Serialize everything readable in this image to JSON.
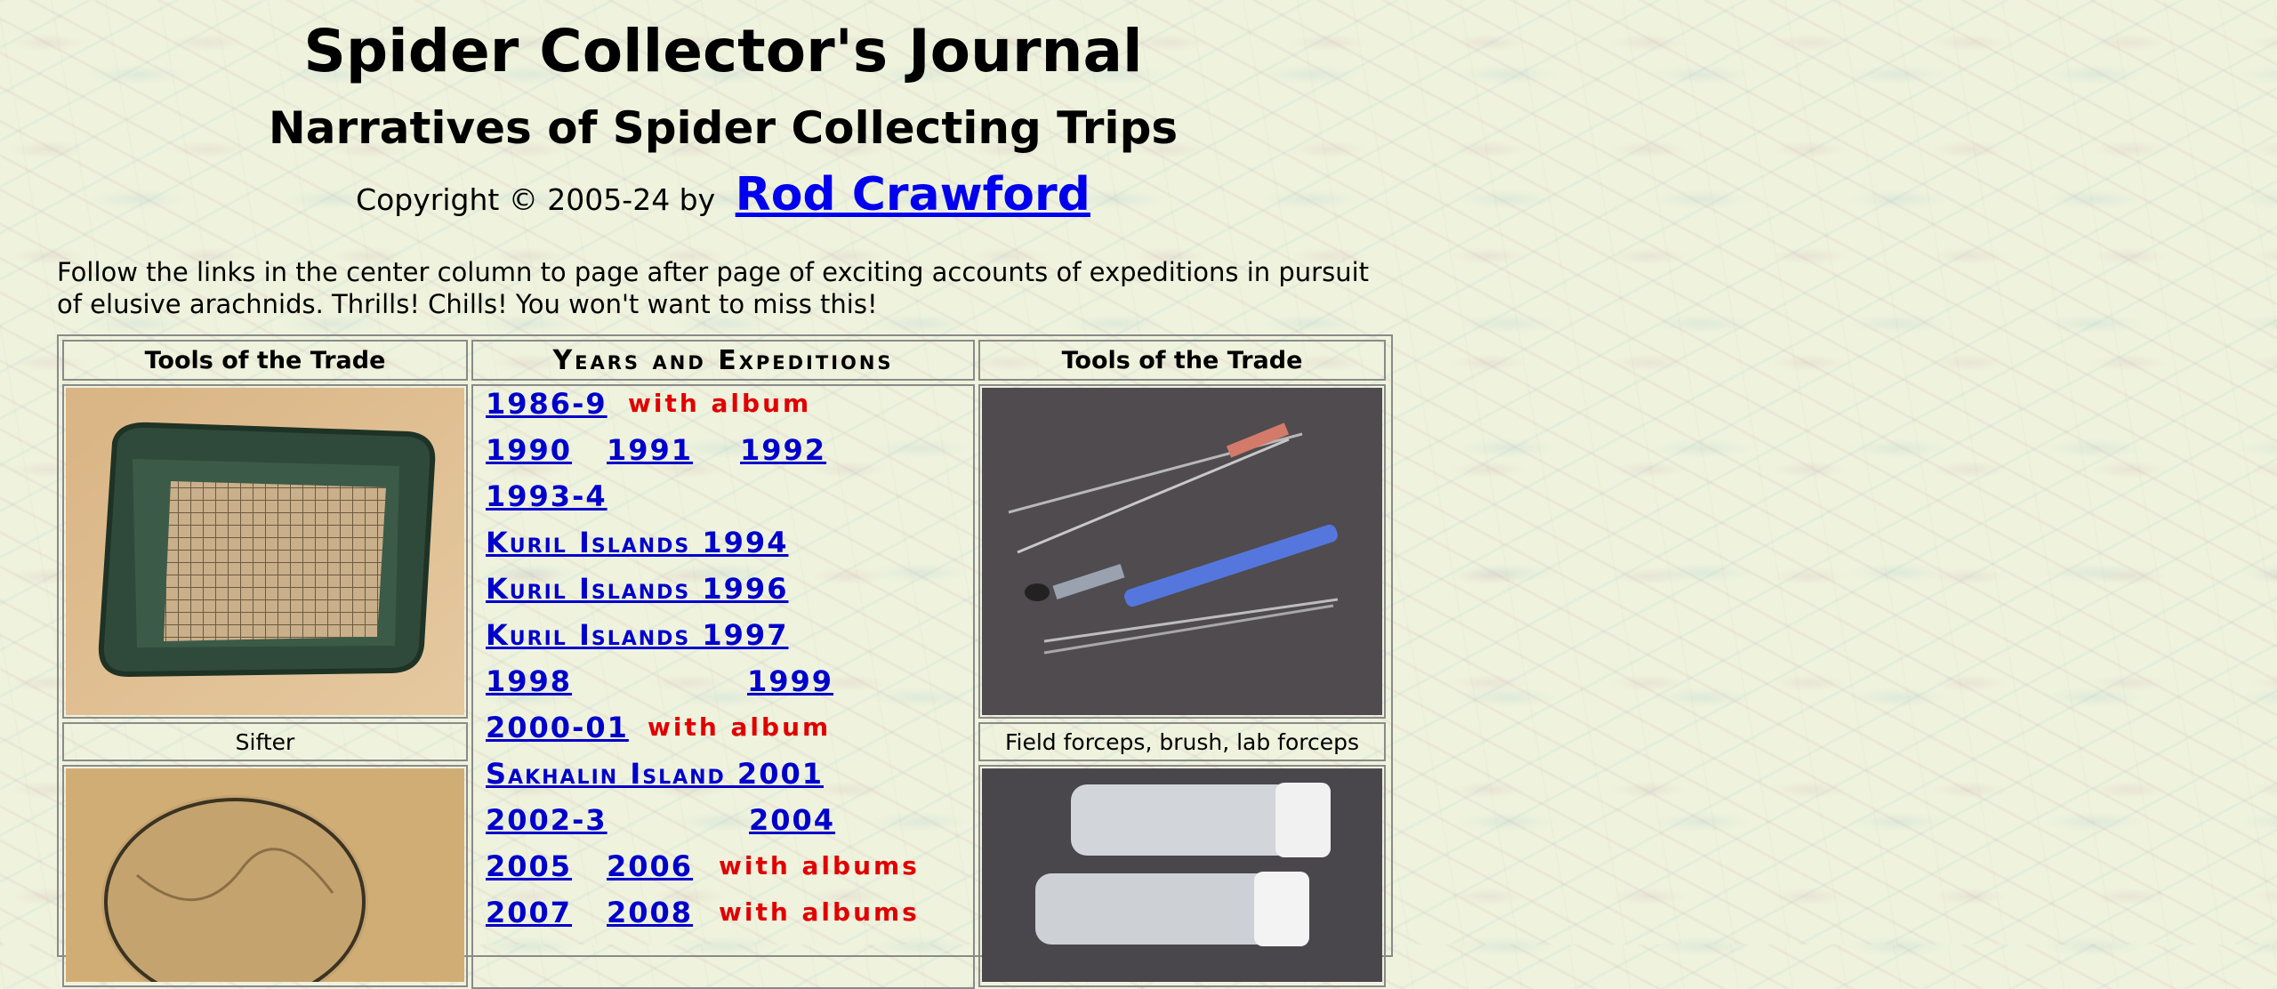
{
  "header": {
    "title": "Spider Collector's Journal",
    "subtitle": "Narratives of Spider Collecting Trips",
    "copyright_prefix": "Copyright © 2005-24 by",
    "author_link": "Rod Crawford"
  },
  "intro": "Follow the links in the center column to page after page of exciting accounts of expeditions in pursuit of elusive arachnids. Thrills! Chills! You won't want to miss this!",
  "left_column": {
    "header": "Tools of the Trade",
    "items": [
      {
        "caption": "Sifter",
        "icon": "sifter-photo"
      },
      {
        "caption": "",
        "icon": "net-photo"
      }
    ]
  },
  "center_column": {
    "header": "Years and Expeditions",
    "rows": [
      {
        "links": [
          "1986-9"
        ],
        "note": "with album"
      },
      {
        "links": [
          "1990",
          "1991",
          "1992"
        ],
        "note": ""
      },
      {
        "links": [
          "1993-4"
        ],
        "note": ""
      },
      {
        "links": [
          "Kuril Islands 1994"
        ],
        "note": ""
      },
      {
        "links": [
          "Kuril Islands 1996"
        ],
        "note": ""
      },
      {
        "links": [
          "Kuril Islands 1997"
        ],
        "note": ""
      },
      {
        "links": [
          "1998",
          "1999"
        ],
        "note": ""
      },
      {
        "links": [
          "2000-01"
        ],
        "note": "with album"
      },
      {
        "links": [
          "Sakhalin Island 2001"
        ],
        "note": ""
      },
      {
        "links": [
          "2002-3",
          "2004"
        ],
        "note": ""
      },
      {
        "links": [
          "2005",
          "2006"
        ],
        "note": "with albums"
      },
      {
        "links": [
          "2007",
          "2008"
        ],
        "note": "with albums"
      }
    ]
  },
  "right_column": {
    "header": "Tools of the Trade",
    "items": [
      {
        "caption": "Field forceps, brush, lab forceps",
        "icon": "forceps-photo"
      },
      {
        "caption": "",
        "icon": "vials-photo"
      }
    ]
  },
  "colors": {
    "link": "#0000cc",
    "album_note": "#e00000",
    "background": "#eff3dd",
    "border": "#8a8a8a"
  }
}
